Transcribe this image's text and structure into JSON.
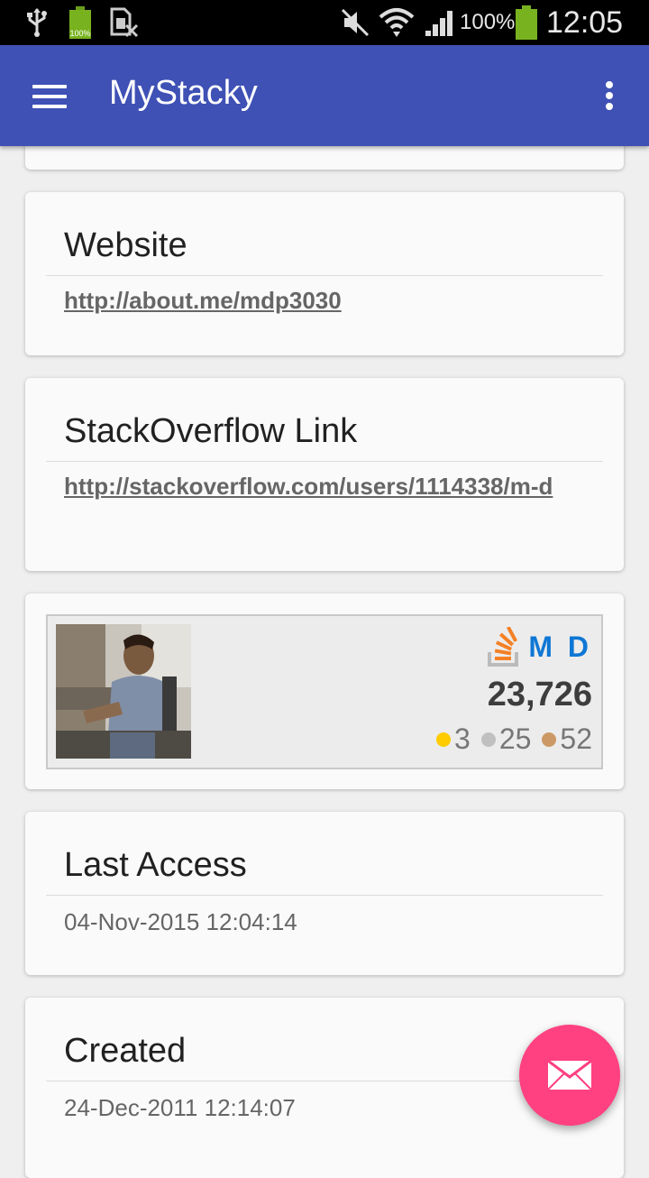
{
  "status_bar": {
    "battery_percent": "100%",
    "time": "12:05",
    "icons": [
      "usb-icon",
      "battery-small-icon",
      "sim-off-icon",
      "mute-icon",
      "wifi-icon",
      "signal-icon",
      "battery-icon"
    ],
    "battery_small_label": "100%"
  },
  "app_bar": {
    "title": "MyStacky",
    "color": "#3f51b5"
  },
  "cards": {
    "website": {
      "title": "Website",
      "link": "http://about.me/mdp3030"
    },
    "stackoverflow": {
      "title": "StackOverflow Link",
      "link": "http://stackoverflow.com/users/1114338/m-d"
    },
    "flair": {
      "name": "M D",
      "reputation": "23,726",
      "gold": "3",
      "silver": "25",
      "bronze": "52",
      "badge_colors": {
        "gold": "#ffcc00",
        "silver": "#c0c0c0",
        "bronze": "#cc9966"
      }
    },
    "last_access": {
      "title": "Last Access",
      "value": "04-Nov-2015 12:04:14"
    },
    "created": {
      "title": "Created",
      "value": "24-Dec-2011 12:14:07"
    }
  },
  "fab": {
    "icon": "mail-icon",
    "color": "#ff4081"
  }
}
